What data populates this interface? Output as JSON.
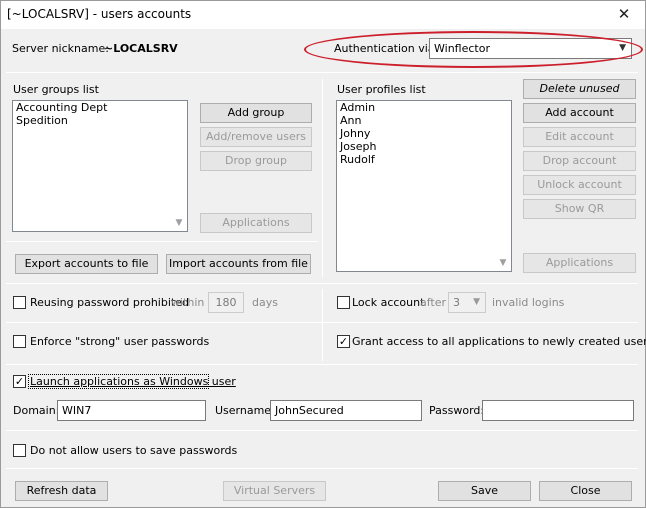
{
  "window": {
    "title": "[~LOCALSRV] - users accounts",
    "close_glyph": "✕"
  },
  "server": {
    "nickname_label": "Server nickname:",
    "nickname_value": "~LOCALSRV"
  },
  "auth": {
    "label": "Authentication via:",
    "value": "Winflector"
  },
  "groups": {
    "label": "User groups list",
    "items": [
      "Accounting Dept",
      "Spedition"
    ],
    "add": "Add group",
    "add_remove_users": "Add/remove users",
    "drop": "Drop group",
    "applications": "Applications"
  },
  "export_btn": "Export accounts to file",
  "import_btn": "Import accounts from file",
  "profiles": {
    "label": "User profiles list",
    "items": [
      "Admin",
      "Ann",
      "Johny",
      "Joseph",
      "Rudolf"
    ],
    "delete_unused": "Delete unused",
    "add": "Add account",
    "edit": "Edit account",
    "drop": "Drop account",
    "unlock": "Unlock account",
    "show_qr": "Show QR",
    "applications": "Applications"
  },
  "reuse": {
    "label": "Reusing password prohibited",
    "within": "within",
    "value": "180",
    "days": "days"
  },
  "lock": {
    "label": "Lock account",
    "after": "after",
    "value": "3",
    "invalid": "invalid logins"
  },
  "strong": {
    "label": "Enforce \"strong\" user passwords"
  },
  "grant": {
    "label": "Grant access to all applications to newly created users"
  },
  "launch": {
    "label": "Launch applications as Windows user"
  },
  "domain": {
    "label": "Domain:",
    "value": "WIN7"
  },
  "username": {
    "label": "Username:",
    "value": "JohnSecured"
  },
  "password": {
    "label": "Password:",
    "value": ""
  },
  "nosave": {
    "label": "Do not allow users to save passwords"
  },
  "footer": {
    "refresh": "Refresh data",
    "virtual_servers": "Virtual Servers",
    "save": "Save",
    "close": "Close"
  },
  "icons": {
    "check": "✓",
    "dropdown": "▼",
    "scroll_down": "▼"
  },
  "colors": {
    "annotation_oval": "#cc1f2b"
  }
}
